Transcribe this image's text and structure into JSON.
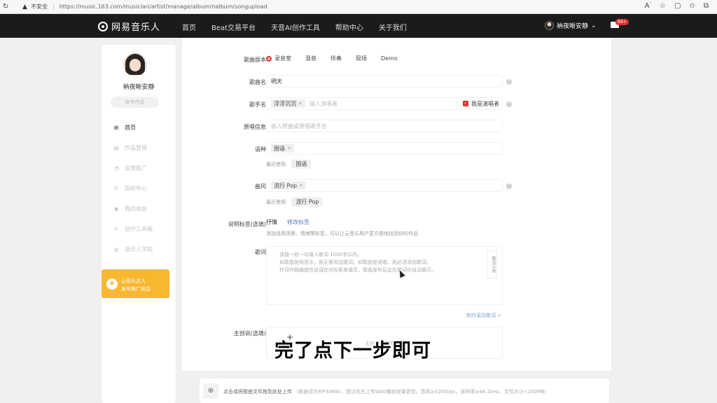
{
  "browser": {
    "reload_icon": "reload-icon",
    "insecure_label": "不安全",
    "url": "https://music.163.com/musician/artist/manage/album/nalbum/songupload"
  },
  "nav": {
    "logo_text": "网易音乐人",
    "links": [
      "首页",
      "Beat交易平台",
      "天音AI创作工具",
      "帮助中心",
      "关于我们"
    ],
    "username": "衲夜晰安静",
    "mail_badge": "99+"
  },
  "sidebar": {
    "name": "衲夜晰安静",
    "publish_label": "发布作品",
    "items": [
      {
        "label": "首页",
        "icon": "grid-icon"
      },
      {
        "label": "作品管理",
        "icon": "doc-icon"
      },
      {
        "label": "运营推广",
        "icon": "megaphone-icon"
      },
      {
        "label": "版权中心",
        "icon": "copyright-icon"
      },
      {
        "label": "我的收益",
        "icon": "coin-icon"
      },
      {
        "label": "创作工具箱",
        "icon": "tools-icon"
      },
      {
        "label": "音乐人学院",
        "icon": "location-icon"
      }
    ],
    "promo_line1": "云音乐达人",
    "promo_line2": "发布推广机会"
  },
  "form": {
    "version_label": "歌曲版本",
    "version_options": [
      "录音室",
      "混音",
      "伴奏",
      "现场",
      "Demo"
    ],
    "name_label": "歌曲名",
    "name_value": "明天",
    "singer_label": "歌手名",
    "singer_tag": "浮浮沉沉",
    "singer_placeholder": "输入演唱者",
    "singer_check": "我是演唱者",
    "original_label": "原唱信息",
    "original_placeholder": "输入原曲或原唱歌手名",
    "language_label": "语种",
    "language_tag": "国语",
    "recent_label": "最近使用:",
    "language_recent": "国语",
    "genre_label": "曲风",
    "genre_tag": "流行 Pop",
    "genre_recent": "流行 Pop",
    "desc_label": "说明标签(选填)",
    "desc_tag": "抒情",
    "desc_edit": "修改标签",
    "desc_hint": "添加适用场景、情绪等标签，可以让云音乐用户更方便地找到你的作品",
    "lyrics_label": "歌词",
    "lyrics_lines": [
      "请按一段一句填入歌词 1000字以内。",
      "如歌曲是纯音乐，则无需添加歌词；如歌曲是说唱，则必须添加歌词。",
      "作词作曲编曲信息请在对应表单填写，歌曲发布后会在歌词中自动展示。"
    ],
    "lyrics_side": "歌词示例",
    "lyric_link": "制作滚动歌词 >",
    "cover_label": "主创说(选填)",
    "cover_dim": "主创说会在歌曲页展示"
  },
  "upload": {
    "main": "点击或将歌曲文件拖到此处上传",
    "sub": "（歌曲须为MP3/WAV，建议优先上传WAV播放效果更佳，音质≥320kbps，采样率≥44.1kHz，文件大小<200MB）"
  },
  "caption": "完了点下一步即可",
  "colors": {
    "accent": "#e03131",
    "promo": "#f7b731",
    "nav_bg": "#1b1b1b"
  }
}
